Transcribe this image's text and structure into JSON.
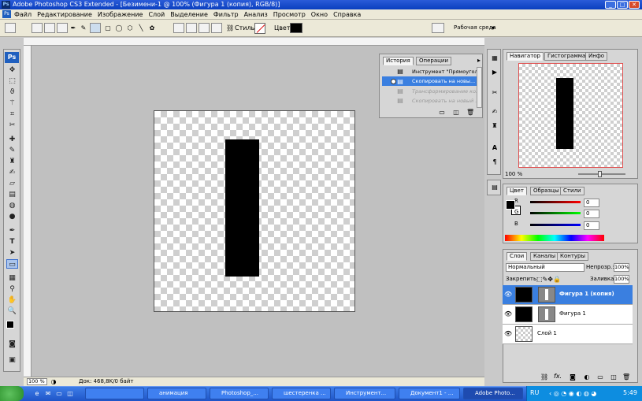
{
  "window": {
    "title": "Adobe Photoshop CS3 Extended - [Безимени-1 @ 100% (Фигура 1 (копия), RGB/8)]",
    "min": "_",
    "max": "□",
    "close": "✕"
  },
  "menu": [
    "Файл",
    "Редактирование",
    "Изображение",
    "Слой",
    "Выделение",
    "Фильтр",
    "Анализ",
    "Просмотр",
    "Окно",
    "Справка"
  ],
  "options": {
    "style_label": "Стиль:",
    "color_label": "Цвет:",
    "workspace": "Рабочая среда"
  },
  "status": {
    "zoom": "100 %",
    "doc": "Док: 468,8K/0 байт"
  },
  "history": {
    "tabs": [
      "История",
      "Операции"
    ],
    "rows": [
      {
        "label": "Инструмент \"Прямоугол...",
        "state": "normal"
      },
      {
        "label": "Скопировать на новы...",
        "state": "selected"
      },
      {
        "label": "Трансформирование ко...",
        "state": "disabled"
      },
      {
        "label": "Скопировать на новый ...",
        "state": "disabled"
      }
    ]
  },
  "navigator": {
    "tabs": [
      "Навигатор",
      "Гистограмма",
      "Инфо"
    ],
    "zoom": "100 %"
  },
  "color": {
    "tabs": [
      "Цвет",
      "Образцы",
      "Стили"
    ],
    "channels": [
      {
        "label": "R",
        "value": "0",
        "color": "#d00000"
      },
      {
        "label": "G",
        "value": "0",
        "color": "#00b000"
      },
      {
        "label": "B",
        "value": "0",
        "color": "#0000c0"
      }
    ]
  },
  "layers": {
    "tabs": [
      "Слои",
      "Каналы",
      "Контуры"
    ],
    "blend_mode": "Нормальный",
    "opacity_label": "Непрозр.:",
    "opacity": "100%",
    "lock_label": "Закрепить:",
    "fill_label": "Заливка:",
    "fill": "100%",
    "items": [
      {
        "name": "Фигура 1 (копия)",
        "selected": true
      },
      {
        "name": "Фигура 1",
        "selected": false
      },
      {
        "name": "Слой 1",
        "selected": false
      }
    ],
    "footer_fx": "fx."
  },
  "taskbar": {
    "buttons": [
      "анимация",
      "Photoshop_...",
      "шестеренка ...",
      "Инструмент...",
      "Документ1 - ...",
      "Adobe Photo..."
    ],
    "lang": "RU",
    "time": "5:49"
  },
  "tools": [
    "move-icon",
    "marquee-icon",
    "lasso-icon",
    "magic-wand-icon",
    "crop-icon",
    "slice-icon",
    "healing-icon",
    "brush-icon",
    "stamp-icon",
    "history-brush-icon",
    "eraser-icon",
    "gradient-icon",
    "blur-icon",
    "dodge-icon",
    "pen-icon",
    "type-icon",
    "path-select-icon",
    "shape-icon",
    "notes-icon",
    "eyedropper-icon",
    "hand-icon",
    "zoom-icon"
  ]
}
